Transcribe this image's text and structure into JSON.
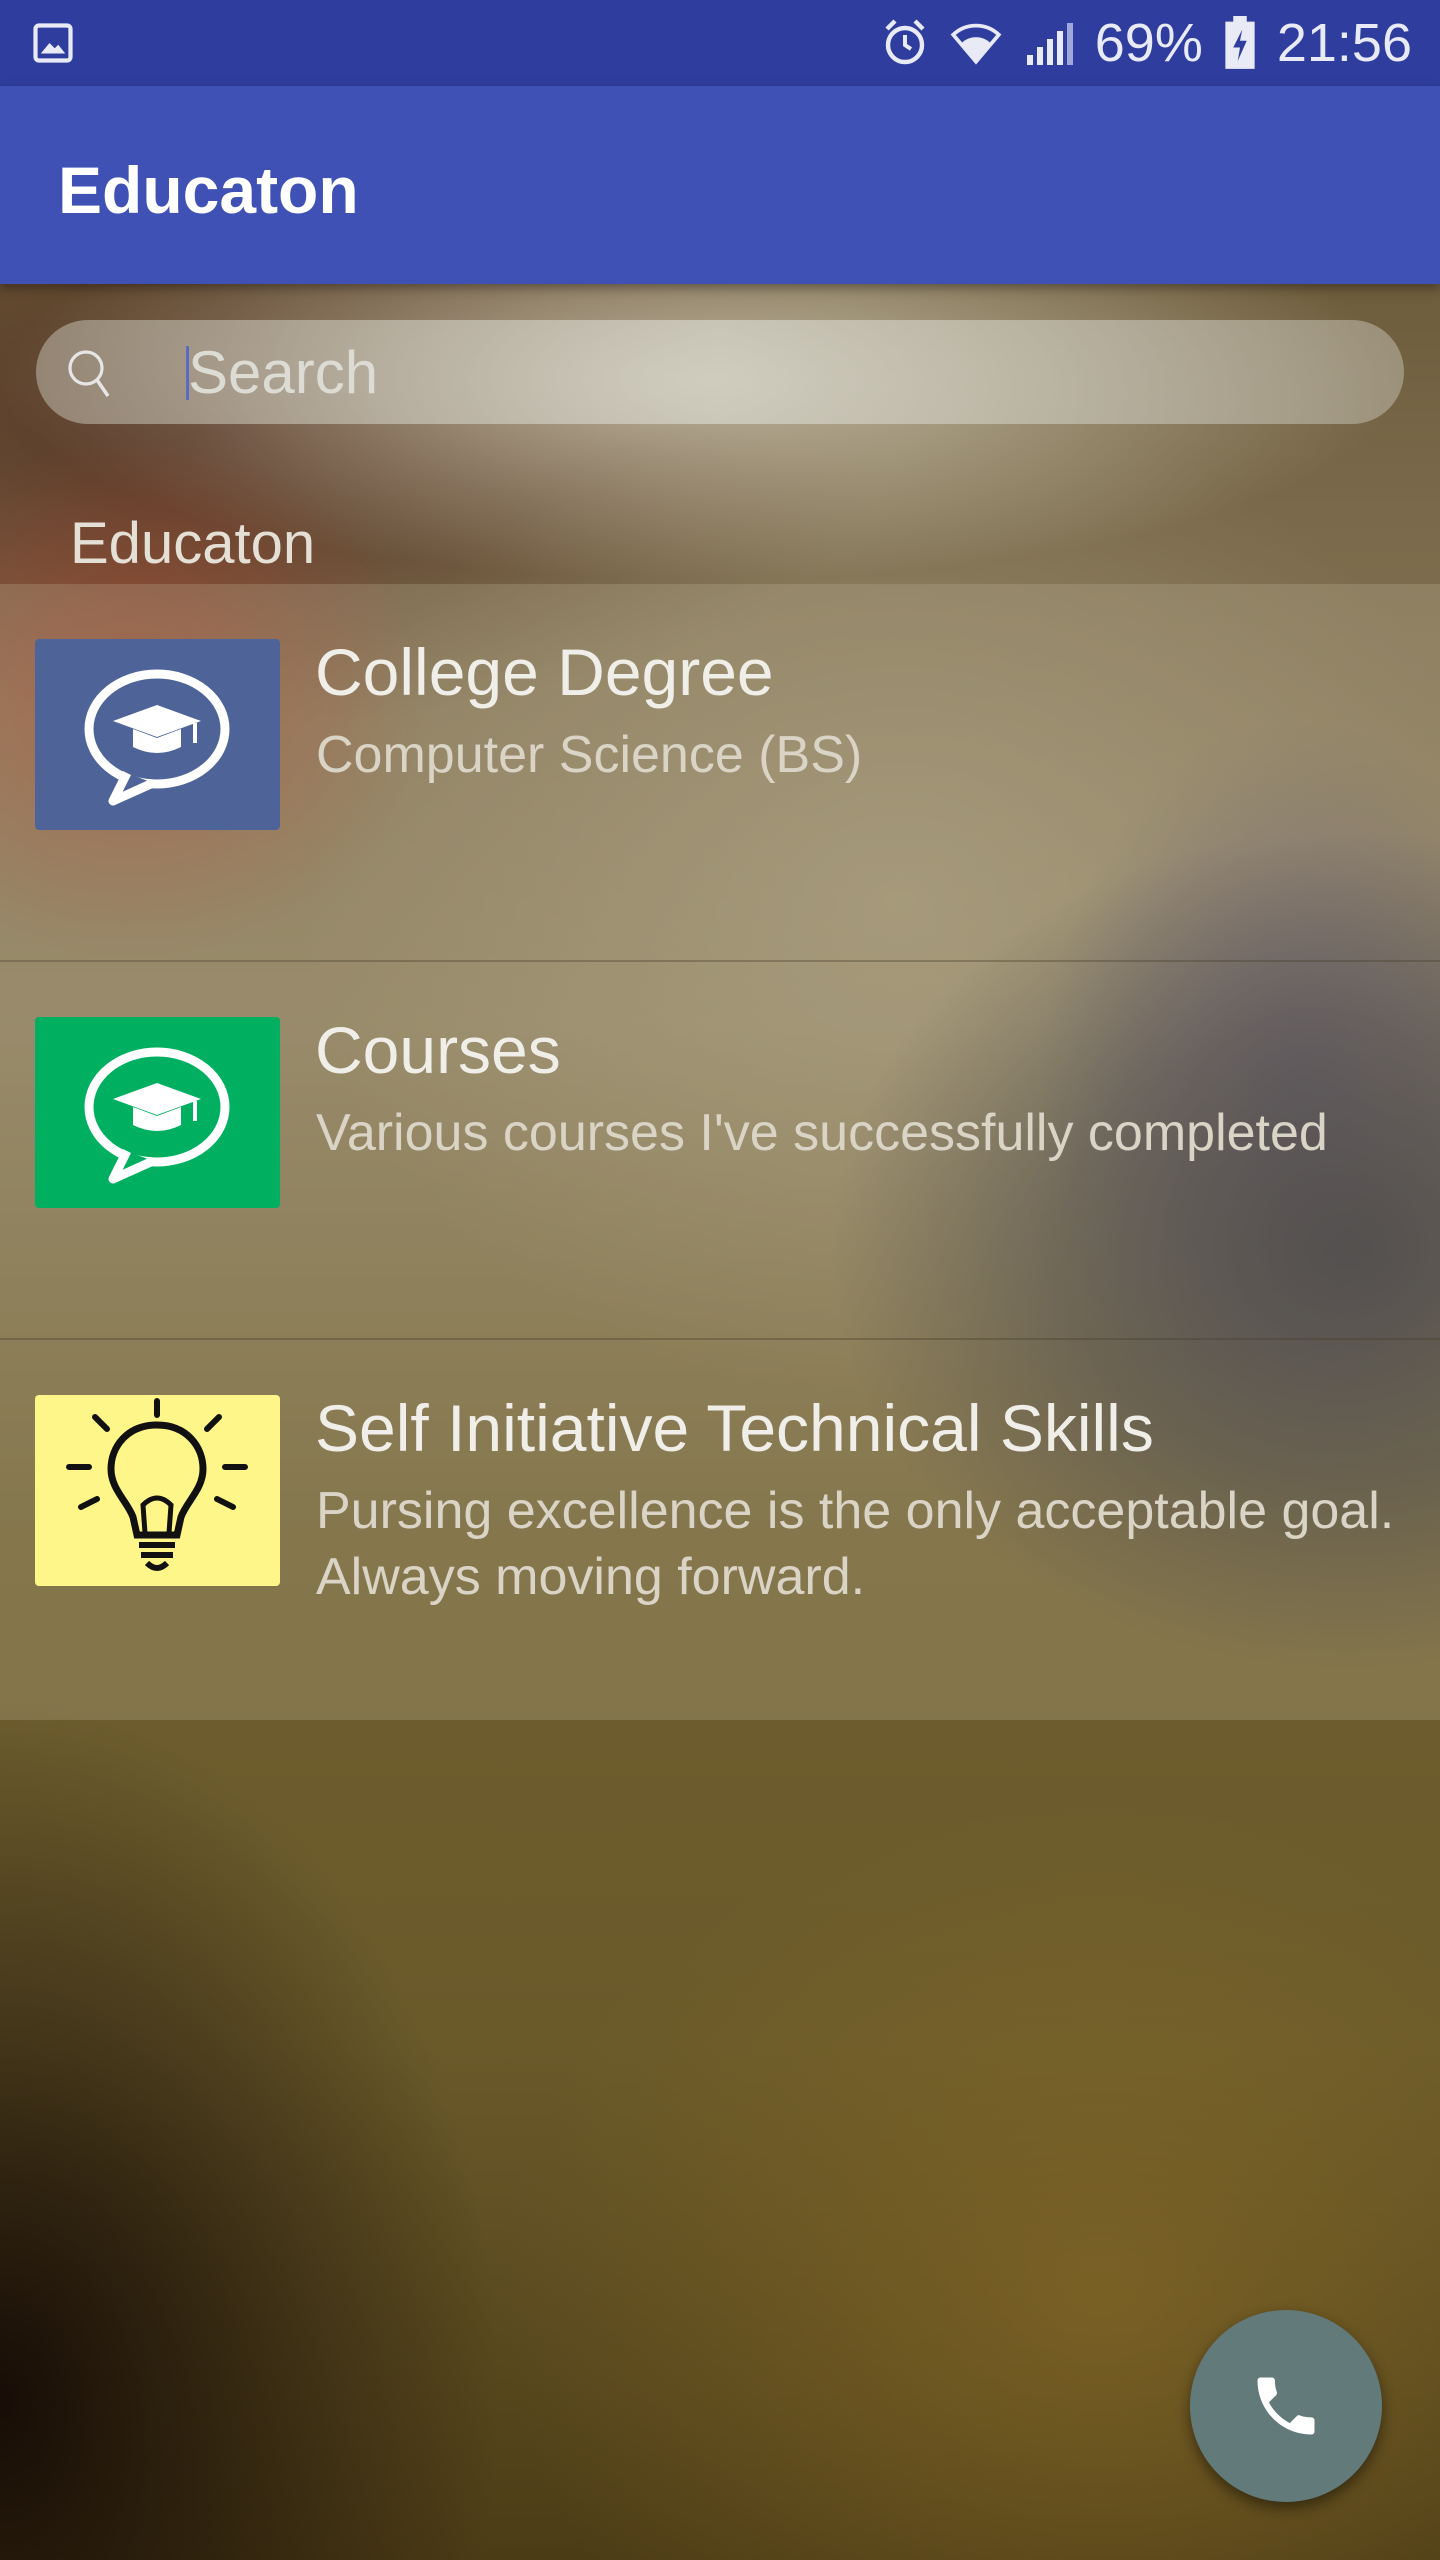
{
  "status_bar": {
    "battery": "69%",
    "time": "21:56",
    "icons": [
      "gallery-icon",
      "alarm-icon",
      "wifi-icon",
      "signal-icon",
      "battery-charging-icon"
    ]
  },
  "app_bar": {
    "title": "Educaton"
  },
  "search": {
    "placeholder": "Search",
    "value": "",
    "icon": "search-icon"
  },
  "section": {
    "header": "Educaton"
  },
  "items": [
    {
      "title": "College Degree",
      "subtitle": "Computer Science (BS)",
      "icon": "graduation-chat-icon",
      "icon_bg": "#4e6498"
    },
    {
      "title": "Courses",
      "subtitle": "Various courses I've successfully completed",
      "icon": "graduation-chat-icon",
      "icon_bg": "#00b060"
    },
    {
      "title": "Self Initiative Technical Skills",
      "subtitle": "Pursing excellence is the only acceptable goal. Always moving forward.",
      "icon": "lightbulb-icon",
      "icon_bg": "#fff68a"
    }
  ],
  "fab": {
    "icon": "phone-icon",
    "color": "#637a7a"
  },
  "colors": {
    "status_bar": "#2f3e9e",
    "app_bar": "#3f51b5",
    "accent": "#5c6bc0"
  }
}
